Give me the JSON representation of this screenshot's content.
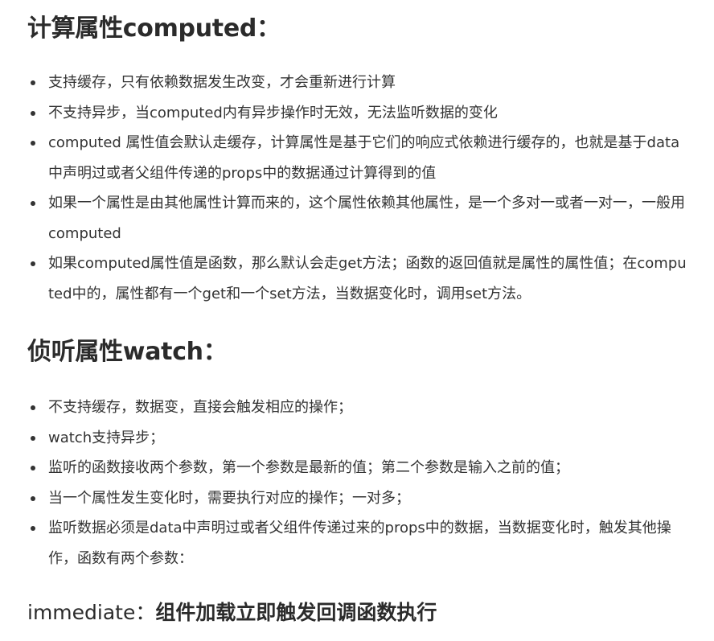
{
  "sections": {
    "computed": {
      "heading": "计算属性computed：",
      "items": [
        "支持缓存，只有依赖数据发生改变，才会重新进行计算",
        "不支持异步，当computed内有异步操作时无效，无法监听数据的变化",
        "computed 属性值会默认走缓存，计算属性是基于它们的响应式依赖进行缓存的，也就是基于data中声明过或者父组件传递的props中的数据通过计算得到的值",
        "如果一个属性是由其他属性计算而来的，这个属性依赖其他属性，是一个多对一或者一对一，一般用computed",
        "如果computed属性值是函数，那么默认会走get方法；函数的返回值就是属性的属性值；在computed中的，属性都有一个get和一个set方法，当数据变化时，调用set方法。"
      ]
    },
    "watch": {
      "heading": "侦听属性watch：",
      "items": [
        "不支持缓存，数据变，直接会触发相应的操作；",
        "watch支持异步；",
        "监听的函数接收两个参数，第一个参数是最新的值；第二个参数是输入之前的值；",
        "当一个属性发生变化时，需要执行对应的操作；一对多；",
        "监听数据必须是data中声明过或者父组件传递过来的props中的数据，当数据变化时，触发其他操作，函数有两个参数："
      ]
    },
    "immediate": {
      "heading_term": "immediate：",
      "heading_desc": "组件加载立即触发回调函数执行"
    }
  }
}
